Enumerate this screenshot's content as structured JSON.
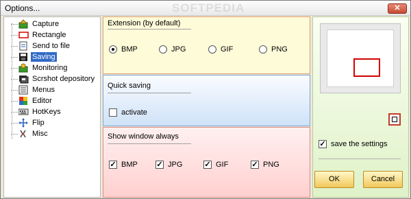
{
  "window": {
    "title": "Options...",
    "watermark": "SOFTPEDIA",
    "close_label": "✕"
  },
  "sidebar": {
    "items": [
      {
        "label": "Capture",
        "icon": "capture-icon"
      },
      {
        "label": "Rectangle",
        "icon": "rectangle-icon"
      },
      {
        "label": "Send to file",
        "icon": "send-to-file-icon"
      },
      {
        "label": "Saving",
        "icon": "floppy-disk-icon",
        "selected": true
      },
      {
        "label": "Monitoring",
        "icon": "monitoring-icon"
      },
      {
        "label": "Scrshot depository",
        "icon": "depository-icon"
      },
      {
        "label": "Menus",
        "icon": "menus-icon"
      },
      {
        "label": "Editor",
        "icon": "editor-icon"
      },
      {
        "label": "HotKeys",
        "icon": "keyboard-icon"
      },
      {
        "label": "Flip",
        "icon": "flip-arrows-icon"
      },
      {
        "label": "Misc",
        "icon": "misc-icon"
      }
    ]
  },
  "extension": {
    "title": "Extension (by default)",
    "options": [
      {
        "label": "BMP",
        "selected": true
      },
      {
        "label": "JPG",
        "selected": false
      },
      {
        "label": "GIF",
        "selected": false
      },
      {
        "label": "PNG",
        "selected": false
      }
    ]
  },
  "quick_saving": {
    "title": "Quick saving",
    "activate_label": "activate",
    "activate_checked": false
  },
  "show_window": {
    "title": "Show window always",
    "options": [
      {
        "label": "BMP",
        "checked": true
      },
      {
        "label": "JPG",
        "checked": true
      },
      {
        "label": "GIF",
        "checked": true
      },
      {
        "label": "PNG",
        "checked": true
      }
    ]
  },
  "right": {
    "save_settings_label": "save the settings",
    "save_settings_checked": true,
    "ok_label": "OK",
    "cancel_label": "Cancel"
  },
  "colors": {
    "selection": "#316ac5",
    "preview_rect": "#d40000",
    "extension_bg": "#fefbd9",
    "quick_bg": "#cfe2f8",
    "show_bg": "#ffd0cf",
    "right_bg": "#dff2c8"
  }
}
